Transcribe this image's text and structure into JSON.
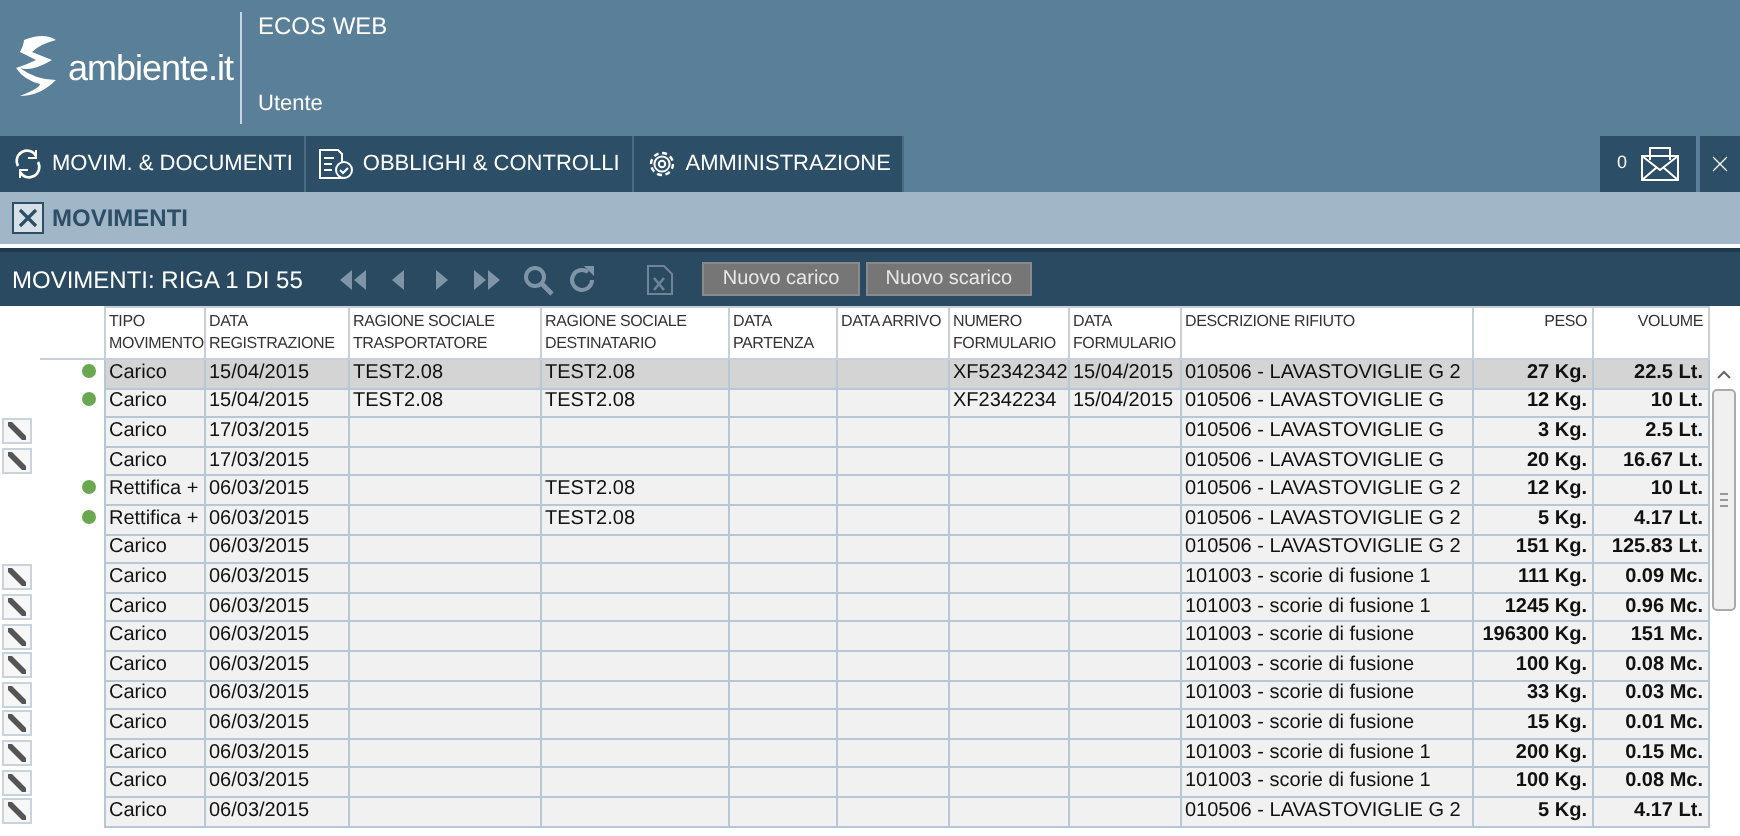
{
  "header": {
    "logo_text": "ambiente.it",
    "app_title": "ECOS WEB",
    "user_label": "Utente"
  },
  "nav_tabs": [
    {
      "label": "MOVIM. & DOCUMENTI",
      "kind": "cycle"
    },
    {
      "label": "OBBLIGHI & CONTROLLI",
      "kind": "doc"
    },
    {
      "label": "AMMINISTRAZIONE",
      "kind": "gear"
    }
  ],
  "notifications": {
    "count": "0"
  },
  "page_title": "MOVIMENTI",
  "toolbar": {
    "record_label": "MOVIMENTI: RIGA 1 DI 55",
    "buttons": [
      "Nuovo carico",
      "Nuovo scarico"
    ]
  },
  "table": {
    "columns": [
      "TIPO MOVIMENTO",
      "DATA REGISTRAZIONE",
      "RAGIONE SOCIALE TRASPORTATORE",
      "RAGIONE SOCIALE DESTINATARIO",
      "DATA PARTENZA",
      "DATA ARRIVO",
      "NUMERO FORMULARIO",
      "DATA FORMULARIO",
      "DESCRIZIONE RIFIUTO",
      "PESO",
      "VOLUME"
    ],
    "rows": [
      {
        "editable": false,
        "status_dot": true,
        "selected": true,
        "cells": [
          "Carico",
          "15/04/2015",
          "TEST2.08",
          "TEST2.08",
          "",
          "",
          "XF52342342",
          "15/04/2015",
          "010506 - LAVASTOVIGLIE G 2",
          "27 Kg.",
          "22.5 Lt."
        ]
      },
      {
        "editable": false,
        "status_dot": true,
        "selected": false,
        "cells": [
          "Carico",
          "15/04/2015",
          "TEST2.08",
          "TEST2.08",
          "",
          "",
          "XF2342234",
          "15/04/2015",
          "010506 - LAVASTOVIGLIE G",
          "12 Kg.",
          "10 Lt."
        ]
      },
      {
        "editable": true,
        "status_dot": false,
        "selected": false,
        "cells": [
          "Carico",
          "17/03/2015",
          "",
          "",
          "",
          "",
          "",
          "",
          "010506 - LAVASTOVIGLIE G",
          "3 Kg.",
          "2.5 Lt."
        ]
      },
      {
        "editable": true,
        "status_dot": false,
        "selected": false,
        "cells": [
          "Carico",
          "17/03/2015",
          "",
          "",
          "",
          "",
          "",
          "",
          "010506 - LAVASTOVIGLIE G",
          "20 Kg.",
          "16.67 Lt."
        ]
      },
      {
        "editable": false,
        "status_dot": true,
        "selected": false,
        "cells": [
          "Rettifica +",
          "06/03/2015",
          "",
          "TEST2.08",
          "",
          "",
          "",
          "",
          "010506 - LAVASTOVIGLIE G 2",
          "12 Kg.",
          "10 Lt."
        ]
      },
      {
        "editable": false,
        "status_dot": true,
        "selected": false,
        "cells": [
          "Rettifica +",
          "06/03/2015",
          "",
          "TEST2.08",
          "",
          "",
          "",
          "",
          "010506 - LAVASTOVIGLIE G 2",
          "5 Kg.",
          "4.17 Lt."
        ]
      },
      {
        "editable": false,
        "status_dot": false,
        "selected": false,
        "cells": [
          "Carico",
          "06/03/2015",
          "",
          "",
          "",
          "",
          "",
          "",
          "010506 - LAVASTOVIGLIE G 2",
          "151 Kg.",
          "125.83 Lt."
        ]
      },
      {
        "editable": true,
        "status_dot": false,
        "selected": false,
        "cells": [
          "Carico",
          "06/03/2015",
          "",
          "",
          "",
          "",
          "",
          "",
          "101003 - scorie di fusione 1",
          "111 Kg.",
          "0.09 Mc."
        ]
      },
      {
        "editable": true,
        "status_dot": false,
        "selected": false,
        "cells": [
          "Carico",
          "06/03/2015",
          "",
          "",
          "",
          "",
          "",
          "",
          "101003 - scorie di fusione 1",
          "1245 Kg.",
          "0.96 Mc."
        ]
      },
      {
        "editable": true,
        "status_dot": false,
        "selected": false,
        "cells": [
          "Carico",
          "06/03/2015",
          "",
          "",
          "",
          "",
          "",
          "",
          "101003 - scorie di fusione",
          "196300 Kg.",
          "151 Mc."
        ]
      },
      {
        "editable": true,
        "status_dot": false,
        "selected": false,
        "cells": [
          "Carico",
          "06/03/2015",
          "",
          "",
          "",
          "",
          "",
          "",
          "101003 - scorie di fusione",
          "100 Kg.",
          "0.08 Mc."
        ]
      },
      {
        "editable": true,
        "status_dot": false,
        "selected": false,
        "cells": [
          "Carico",
          "06/03/2015",
          "",
          "",
          "",
          "",
          "",
          "",
          "101003 - scorie di fusione",
          "33 Kg.",
          "0.03 Mc."
        ]
      },
      {
        "editable": true,
        "status_dot": false,
        "selected": false,
        "cells": [
          "Carico",
          "06/03/2015",
          "",
          "",
          "",
          "",
          "",
          "",
          "101003 - scorie di fusione",
          "15 Kg.",
          "0.01 Mc."
        ]
      },
      {
        "editable": true,
        "status_dot": false,
        "selected": false,
        "cells": [
          "Carico",
          "06/03/2015",
          "",
          "",
          "",
          "",
          "",
          "",
          "101003 - scorie di fusione 1",
          "200 Kg.",
          "0.15 Mc."
        ]
      },
      {
        "editable": true,
        "status_dot": false,
        "selected": false,
        "cells": [
          "Carico",
          "06/03/2015",
          "",
          "",
          "",
          "",
          "",
          "",
          "101003 - scorie di fusione 1",
          "100 Kg.",
          "0.08 Mc."
        ]
      },
      {
        "editable": true,
        "status_dot": false,
        "selected": false,
        "cells": [
          "Carico",
          "06/03/2015",
          "",
          "",
          "",
          "",
          "",
          "",
          "010506 - LAVASTOVIGLIE G 2",
          "5 Kg.",
          "4.17 Lt."
        ]
      }
    ]
  }
}
